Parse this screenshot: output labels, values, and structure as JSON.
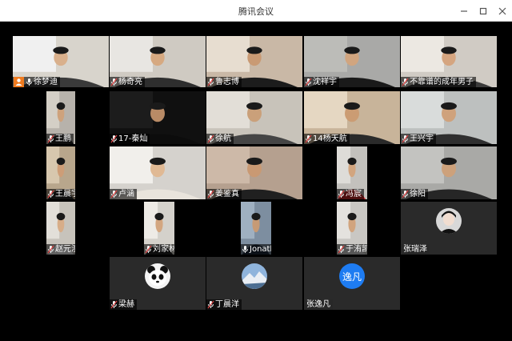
{
  "window": {
    "title": "腾讯会议"
  },
  "colors": {
    "host_badge": "#f07b1f",
    "avatar_blue": "#1e7cf2",
    "tile_dark": "#2a2a2a"
  },
  "participants": [
    {
      "name": "徐梦迪",
      "host": true,
      "mic": "on"
    },
    {
      "name": "杨奇亮",
      "mic": "muted"
    },
    {
      "name": "鲁志博",
      "mic": "muted"
    },
    {
      "name": "沈祥宇",
      "mic": "muted"
    },
    {
      "name": "不靠谱的成年男子",
      "mic": "muted"
    },
    {
      "name": "王鹏",
      "mic": "muted"
    },
    {
      "name": "17-秦灿",
      "mic": "muted"
    },
    {
      "name": "徐航",
      "mic": "muted"
    },
    {
      "name": "14杨天航",
      "mic": "muted"
    },
    {
      "name": "王兴宇",
      "mic": "muted"
    },
    {
      "name": "王晨宇",
      "mic": "muted"
    },
    {
      "name": "卢涵",
      "mic": "muted"
    },
    {
      "name": "姜鉴真",
      "mic": "muted"
    },
    {
      "name": "冯宸",
      "mic": "muted"
    },
    {
      "name": "徐阳",
      "mic": "muted"
    },
    {
      "name": "赵元澧",
      "mic": "muted"
    },
    {
      "name": "刘家林",
      "mic": "muted"
    },
    {
      "name": "Jonathan",
      "mic": "on"
    },
    {
      "name": "于洧凯",
      "mic": "muted"
    },
    {
      "name": "张瑞泽",
      "mic": "none",
      "avatar": "photo-dark"
    },
    {
      "name": "梁赫",
      "mic": "muted",
      "avatar": "panda"
    },
    {
      "name": "丁晨洋",
      "mic": "muted",
      "avatar": "landscape"
    },
    {
      "name": "张逸凡",
      "mic": "none",
      "avatar": "text",
      "avatar_text": "逸凡"
    }
  ]
}
